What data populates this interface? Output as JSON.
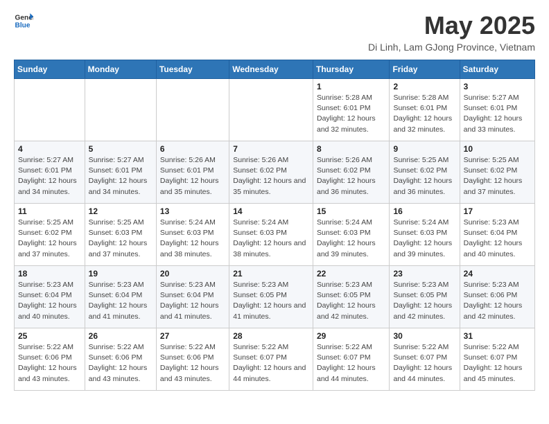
{
  "header": {
    "logo_general": "General",
    "logo_blue": "Blue",
    "title": "May 2025",
    "subtitle": "Di Linh, Lam GJong Province, Vietnam"
  },
  "calendar": {
    "days_of_week": [
      "Sunday",
      "Monday",
      "Tuesday",
      "Wednesday",
      "Thursday",
      "Friday",
      "Saturday"
    ],
    "weeks": [
      {
        "days": [
          {
            "num": "",
            "info": ""
          },
          {
            "num": "",
            "info": ""
          },
          {
            "num": "",
            "info": ""
          },
          {
            "num": "",
            "info": ""
          },
          {
            "num": "1",
            "info": "Sunrise: 5:28 AM\nSunset: 6:01 PM\nDaylight: 12 hours\nand 32 minutes."
          },
          {
            "num": "2",
            "info": "Sunrise: 5:28 AM\nSunset: 6:01 PM\nDaylight: 12 hours\nand 32 minutes."
          },
          {
            "num": "3",
            "info": "Sunrise: 5:27 AM\nSunset: 6:01 PM\nDaylight: 12 hours\nand 33 minutes."
          }
        ]
      },
      {
        "days": [
          {
            "num": "4",
            "info": "Sunrise: 5:27 AM\nSunset: 6:01 PM\nDaylight: 12 hours\nand 34 minutes."
          },
          {
            "num": "5",
            "info": "Sunrise: 5:27 AM\nSunset: 6:01 PM\nDaylight: 12 hours\nand 34 minutes."
          },
          {
            "num": "6",
            "info": "Sunrise: 5:26 AM\nSunset: 6:01 PM\nDaylight: 12 hours\nand 35 minutes."
          },
          {
            "num": "7",
            "info": "Sunrise: 5:26 AM\nSunset: 6:02 PM\nDaylight: 12 hours\nand 35 minutes."
          },
          {
            "num": "8",
            "info": "Sunrise: 5:26 AM\nSunset: 6:02 PM\nDaylight: 12 hours\nand 36 minutes."
          },
          {
            "num": "9",
            "info": "Sunrise: 5:25 AM\nSunset: 6:02 PM\nDaylight: 12 hours\nand 36 minutes."
          },
          {
            "num": "10",
            "info": "Sunrise: 5:25 AM\nSunset: 6:02 PM\nDaylight: 12 hours\nand 37 minutes."
          }
        ]
      },
      {
        "days": [
          {
            "num": "11",
            "info": "Sunrise: 5:25 AM\nSunset: 6:02 PM\nDaylight: 12 hours\nand 37 minutes."
          },
          {
            "num": "12",
            "info": "Sunrise: 5:25 AM\nSunset: 6:03 PM\nDaylight: 12 hours\nand 37 minutes."
          },
          {
            "num": "13",
            "info": "Sunrise: 5:24 AM\nSunset: 6:03 PM\nDaylight: 12 hours\nand 38 minutes."
          },
          {
            "num": "14",
            "info": "Sunrise: 5:24 AM\nSunset: 6:03 PM\nDaylight: 12 hours\nand 38 minutes."
          },
          {
            "num": "15",
            "info": "Sunrise: 5:24 AM\nSunset: 6:03 PM\nDaylight: 12 hours\nand 39 minutes."
          },
          {
            "num": "16",
            "info": "Sunrise: 5:24 AM\nSunset: 6:03 PM\nDaylight: 12 hours\nand 39 minutes."
          },
          {
            "num": "17",
            "info": "Sunrise: 5:23 AM\nSunset: 6:04 PM\nDaylight: 12 hours\nand 40 minutes."
          }
        ]
      },
      {
        "days": [
          {
            "num": "18",
            "info": "Sunrise: 5:23 AM\nSunset: 6:04 PM\nDaylight: 12 hours\nand 40 minutes."
          },
          {
            "num": "19",
            "info": "Sunrise: 5:23 AM\nSunset: 6:04 PM\nDaylight: 12 hours\nand 41 minutes."
          },
          {
            "num": "20",
            "info": "Sunrise: 5:23 AM\nSunset: 6:04 PM\nDaylight: 12 hours\nand 41 minutes."
          },
          {
            "num": "21",
            "info": "Sunrise: 5:23 AM\nSunset: 6:05 PM\nDaylight: 12 hours\nand 41 minutes."
          },
          {
            "num": "22",
            "info": "Sunrise: 5:23 AM\nSunset: 6:05 PM\nDaylight: 12 hours\nand 42 minutes."
          },
          {
            "num": "23",
            "info": "Sunrise: 5:23 AM\nSunset: 6:05 PM\nDaylight: 12 hours\nand 42 minutes."
          },
          {
            "num": "24",
            "info": "Sunrise: 5:23 AM\nSunset: 6:06 PM\nDaylight: 12 hours\nand 42 minutes."
          }
        ]
      },
      {
        "days": [
          {
            "num": "25",
            "info": "Sunrise: 5:22 AM\nSunset: 6:06 PM\nDaylight: 12 hours\nand 43 minutes."
          },
          {
            "num": "26",
            "info": "Sunrise: 5:22 AM\nSunset: 6:06 PM\nDaylight: 12 hours\nand 43 minutes."
          },
          {
            "num": "27",
            "info": "Sunrise: 5:22 AM\nSunset: 6:06 PM\nDaylight: 12 hours\nand 43 minutes."
          },
          {
            "num": "28",
            "info": "Sunrise: 5:22 AM\nSunset: 6:07 PM\nDaylight: 12 hours\nand 44 minutes."
          },
          {
            "num": "29",
            "info": "Sunrise: 5:22 AM\nSunset: 6:07 PM\nDaylight: 12 hours\nand 44 minutes."
          },
          {
            "num": "30",
            "info": "Sunrise: 5:22 AM\nSunset: 6:07 PM\nDaylight: 12 hours\nand 44 minutes."
          },
          {
            "num": "31",
            "info": "Sunrise: 5:22 AM\nSunset: 6:07 PM\nDaylight: 12 hours\nand 45 minutes."
          }
        ]
      }
    ]
  }
}
